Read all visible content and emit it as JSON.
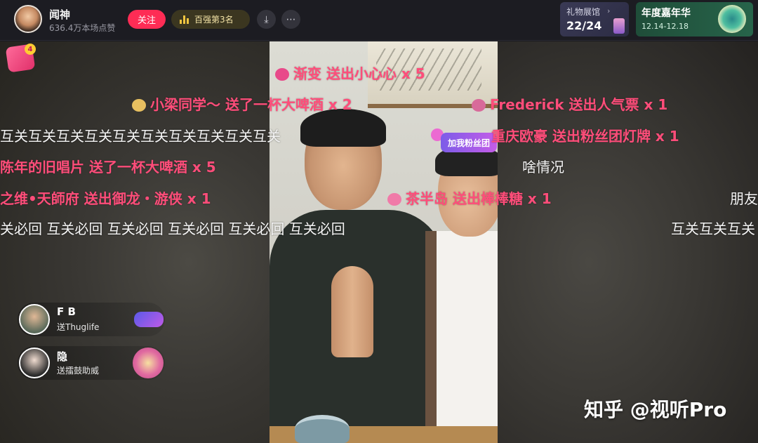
{
  "streamer": {
    "name": "闻神",
    "likes": "636.4万本场点赞",
    "follow_label": "关注",
    "rank_label": "百强第3名"
  },
  "gift_gallery": {
    "title": "礼物展馆",
    "progress": "22/24"
  },
  "gala": {
    "title": "年度嘉年华",
    "dates": "12.14-12.18"
  },
  "gift_bag_count": "4",
  "fan_badge": "加我粉丝团",
  "danmaku": [
    {
      "text": "渐变  送出小心心 x 5",
      "style": "gift"
    },
    {
      "text": "小梁同学～  送了一杯大啤酒 x 2",
      "style": "gift"
    },
    {
      "text": "Frederick  送出人气票 x 1",
      "style": "gift"
    },
    {
      "text": "互关互关互关互关互关互关互关互关互关互关",
      "style": "white"
    },
    {
      "text": "重庆欧豪  送出粉丝团灯牌 x 1",
      "style": "gift"
    },
    {
      "text": "陈年的旧唱片  送了一杯大啤酒 x 5",
      "style": "gift"
    },
    {
      "text": "啥情况",
      "style": "white"
    },
    {
      "text": "之维•天師府  送出御龙・游侠 x 1",
      "style": "gift"
    },
    {
      "text": "茶半岛  送出棒棒糖 x 1",
      "style": "gift"
    },
    {
      "text": "朋友",
      "style": "white"
    },
    {
      "text": "关必回  互关必回  互关必回  互关必回  互关必回  互关必回",
      "style": "white"
    },
    {
      "text": "互关互关互关",
      "style": "white"
    }
  ],
  "gift_feed": [
    {
      "user": "F B",
      "action": "送Thuglife"
    },
    {
      "user": "隐",
      "action": "送擂鼓助威"
    }
  ],
  "watermark": "知乎 @视听Pro",
  "colors": {
    "follow": "#fe2c55",
    "gift_text": "#ff4d7a",
    "rank_gold": "#f0c540"
  }
}
